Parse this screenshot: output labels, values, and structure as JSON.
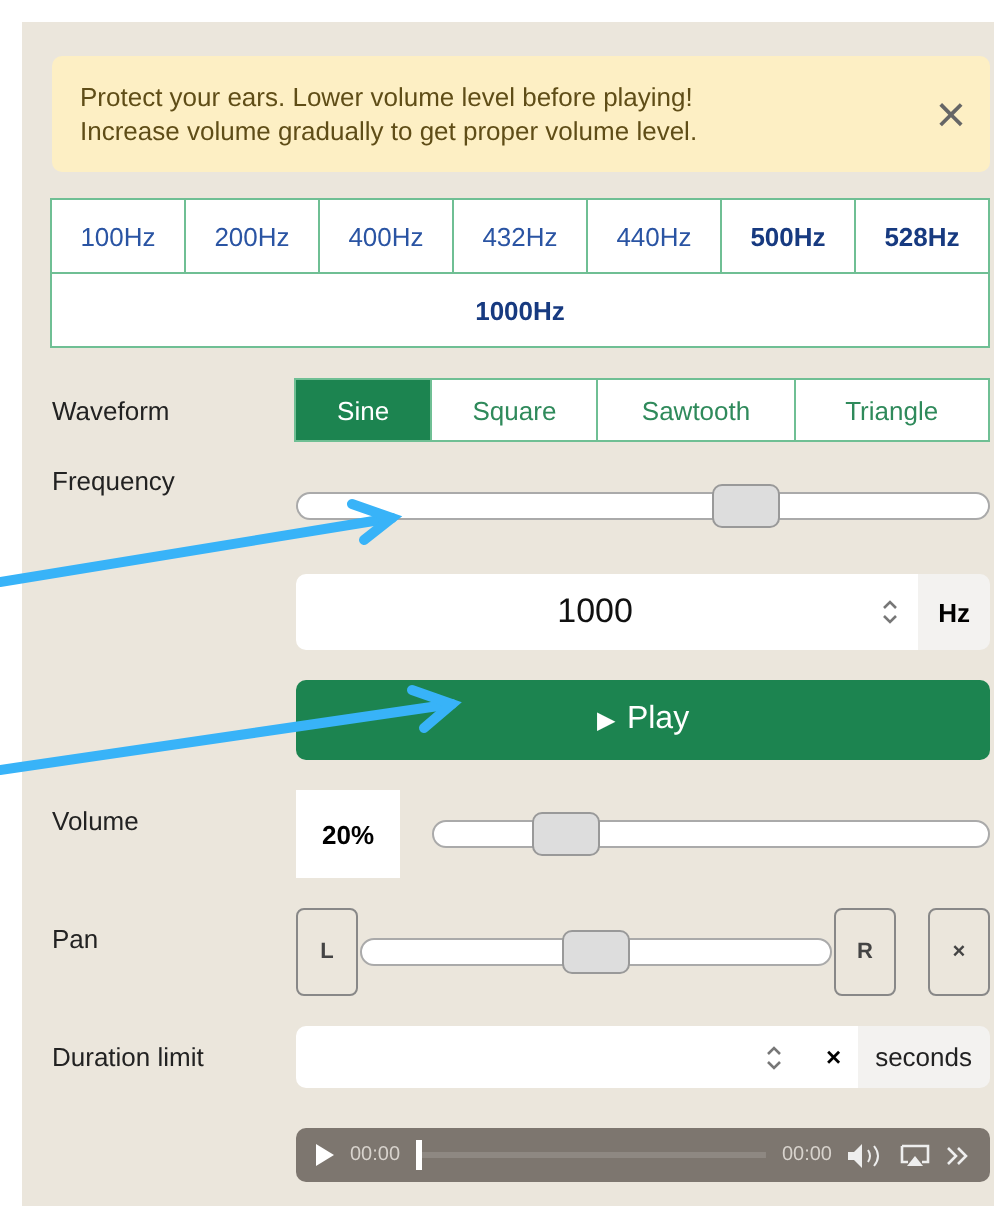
{
  "alert": {
    "lines": [
      "Protect your ears. Lower volume level before playing!",
      "Increase volume gradually to get proper volume level."
    ],
    "close": "×"
  },
  "presets": [
    {
      "label": "100Hz",
      "bold": false
    },
    {
      "label": "200Hz",
      "bold": false
    },
    {
      "label": "400Hz",
      "bold": false
    },
    {
      "label": "432Hz",
      "bold": false
    },
    {
      "label": "440Hz",
      "bold": false
    },
    {
      "label": "500Hz",
      "bold": true
    },
    {
      "label": "528Hz",
      "bold": true
    },
    {
      "label": "1000Hz",
      "bold": true
    }
  ],
  "waveform": {
    "label": "Waveform",
    "options": [
      {
        "label": "Sine",
        "selected": true
      },
      {
        "label": "Square",
        "selected": false
      },
      {
        "label": "Sawtooth",
        "selected": false
      },
      {
        "label": "Triangle",
        "selected": false
      }
    ]
  },
  "frequency": {
    "label": "Frequency",
    "level": 0.65,
    "value": "1000",
    "unit": "Hz"
  },
  "play": {
    "icon": "▶",
    "label": "Play"
  },
  "volume": {
    "label": "Volume",
    "reading": "20%",
    "level": 0.24
  },
  "pan": {
    "label": "Pan",
    "left": "L",
    "right": "R",
    "reset": "×",
    "level": 0.5
  },
  "duration": {
    "label": "Duration limit",
    "clear": "×",
    "unit": "seconds"
  },
  "player": {
    "current": "00:00",
    "total": "00:00",
    "level": 0
  }
}
